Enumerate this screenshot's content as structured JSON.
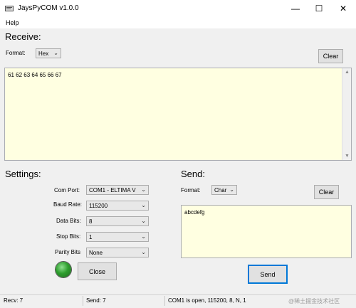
{
  "window": {
    "title": "JaysPyCOM v1.0.0",
    "minimize_glyph": "—",
    "maximize_glyph": "☐",
    "close_glyph": "✕"
  },
  "menu": {
    "help": "Help"
  },
  "receive": {
    "title": "Receive:",
    "format_label": "Format:",
    "format_value": "Hex",
    "clear_label": "Clear",
    "text": "61 62 63 64 65 66 67"
  },
  "settings": {
    "title": "Settings:",
    "com_port_label": "Com Port:",
    "com_port_value": "COM1 - ELTIMA V",
    "baud_rate_label": "Baud Rate:",
    "baud_rate_value": "115200",
    "data_bits_label": "Data Bits:",
    "data_bits_value": "8",
    "stop_bits_label": "Stop Bits:",
    "stop_bits_value": "1",
    "parity_label": "Parity Bits",
    "parity_value": "None",
    "close_label": "Close",
    "status_led_color": "#2e9e2e"
  },
  "send": {
    "title": "Send:",
    "format_label": "Format:",
    "format_value": "Char",
    "clear_label": "Clear",
    "text": "abcdefg",
    "send_label": "Send",
    "send_border_color": "#0078d7"
  },
  "status": {
    "recv": "Recv: 7",
    "send": "Send: 7",
    "port": "COM1 is open, 115200, 8, N, 1",
    "watermark": "@稀土掘金技术社区"
  }
}
